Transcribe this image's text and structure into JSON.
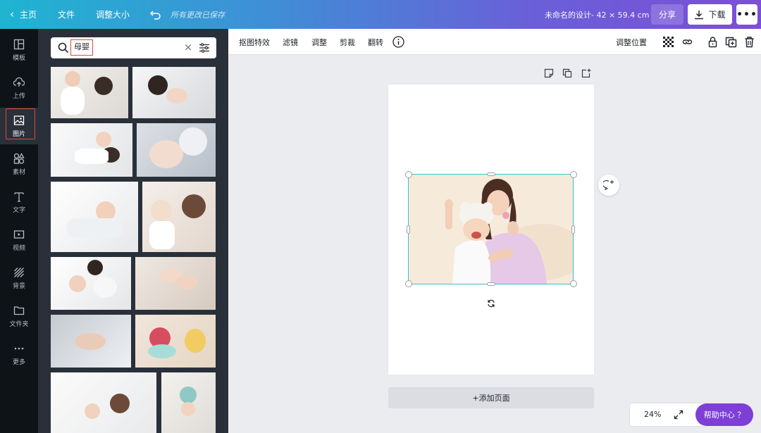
{
  "topbar": {
    "home_label": "主页",
    "file_label": "文件",
    "resize_label": "调整大小",
    "saved_status": "所有更改已保存",
    "design_title": "未命名的设计- 42 × 59.4 cm",
    "share_label": "分享",
    "download_label": "下载",
    "more_label": "•••"
  },
  "leftnav": {
    "items": [
      {
        "label": "模板",
        "icon": "template-icon"
      },
      {
        "label": "上传",
        "icon": "upload-icon"
      },
      {
        "label": "图片",
        "icon": "image-icon",
        "active": true
      },
      {
        "label": "素材",
        "icon": "elements-icon"
      },
      {
        "label": "文字",
        "icon": "text-icon"
      },
      {
        "label": "视频",
        "icon": "video-icon"
      },
      {
        "label": "背景",
        "icon": "background-icon"
      },
      {
        "label": "文件夹",
        "icon": "folder-icon"
      },
      {
        "label": "更多",
        "icon": "more-icon"
      }
    ]
  },
  "panel": {
    "search_query": "母婴"
  },
  "toolbar": {
    "remove_bg": "抠图特效",
    "filter": "滤镜",
    "adjust": "调整",
    "crop": "剪裁",
    "flip": "翻转",
    "position": "调整位置"
  },
  "canvas": {
    "add_page": "+添加页面",
    "zoom": "24%",
    "help": "帮助中心 ？"
  },
  "colors": {
    "accent_gradient_start": "#1fb4d2",
    "accent_gradient_end": "#7b4fd6",
    "selection": "#38c0cf",
    "highlight": "#e04a3a",
    "help_button": "#7d3fd6"
  }
}
